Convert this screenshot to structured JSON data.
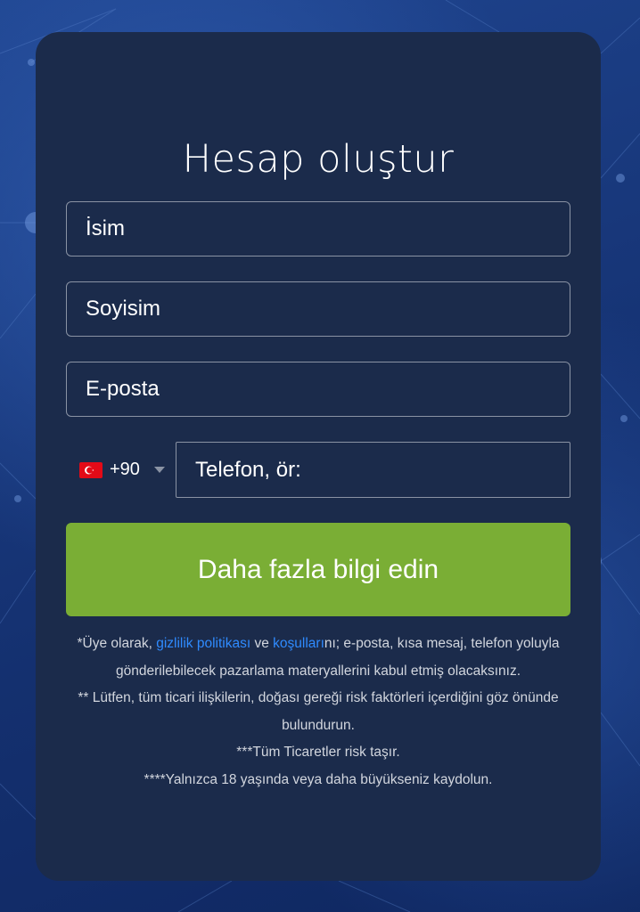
{
  "form": {
    "title": "Hesap oluştur",
    "name_placeholder": "İsim",
    "surname_placeholder": "Soyisim",
    "email_placeholder": "E-posta",
    "phone": {
      "country_flag": "turkey-flag-icon",
      "dial_code": "+90",
      "placeholder": "Telefon, ör:"
    },
    "submit_label": "Daha fazla bilgi edin"
  },
  "legal": {
    "line1_prefix": "*Üye olarak, ",
    "privacy_link": "gizlilik politikası",
    "line1_mid": " ve ",
    "terms_link": "koşulları",
    "line1_suffix": "nı; e-posta, kısa mesaj, telefon yoluyla gönderilebilecek pazarlama materyallerini kabul etmiş olacaksınız.",
    "line2": "** Lütfen, tüm ticari ilişkilerin, doğası gereği risk faktörleri içerdiğini göz önünde bulundurun.",
    "line3": "***Tüm Ticaretler risk taşır.",
    "line4": "****Yalnızca 18 yaşında veya daha büyükseniz kaydolun."
  },
  "colors": {
    "background": "#16367a",
    "card": "#1b2b4b",
    "button": "#7aae35",
    "link": "#2f8bff",
    "field_border": "#8a93a4"
  }
}
